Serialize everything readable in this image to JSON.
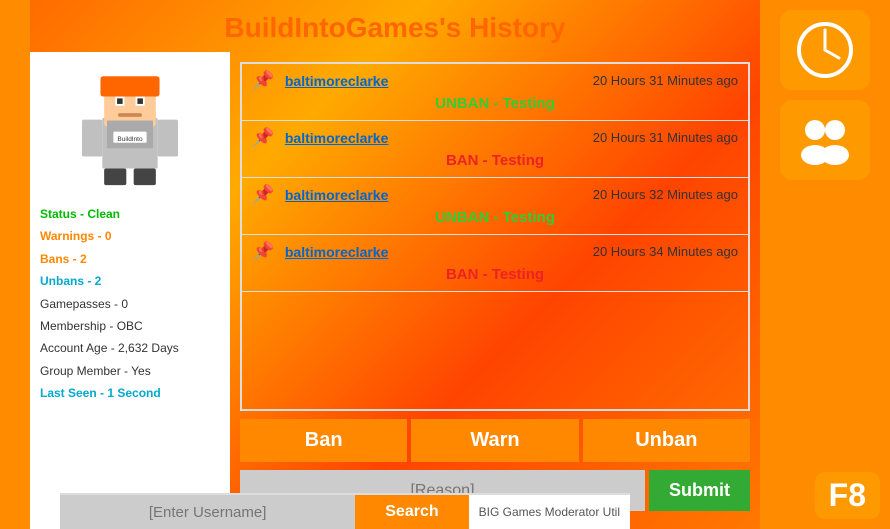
{
  "page": {
    "title": "BuildIntoGames's History"
  },
  "user": {
    "status_label": "Status - Clean",
    "warnings_label": "Warnings - 0",
    "bans_label": "Bans - 2",
    "unbans_label": "Unbans - 2",
    "gamepasses_label": "Gamepasses - 0",
    "membership_label": "Membership - OBC",
    "account_age_label": "Account Age - 2,632 Days",
    "group_member_label": "Group Member - Yes",
    "last_seen_label": "Last Seen - 1 Second"
  },
  "history": [
    {
      "username": "baltimoreclarke",
      "time": "20 Hours 31 Minutes ago",
      "action": "UNBAN - Testing",
      "action_type": "unban"
    },
    {
      "username": "baltimoreclarke",
      "time": "20 Hours 31 Minutes ago",
      "action": "BAN - Testing",
      "action_type": "ban"
    },
    {
      "username": "baltimoreclarke",
      "time": "20 Hours 32 Minutes ago",
      "action": "UNBAN - Testing",
      "action_type": "unban"
    },
    {
      "username": "baltimoreclarke",
      "time": "20 Hours 34 Minutes ago",
      "action": "BAN - Testing",
      "action_type": "ban"
    }
  ],
  "buttons": {
    "ban": "Ban",
    "warn": "Warn",
    "unban": "Unban",
    "submit": "Submit",
    "search": "Search"
  },
  "inputs": {
    "reason_placeholder": "[Reason]",
    "username_placeholder": "[Enter Username]"
  },
  "footer": {
    "util_label": "BIG Games Moderator Util"
  },
  "sidebar": {
    "f8_label": "F8"
  }
}
